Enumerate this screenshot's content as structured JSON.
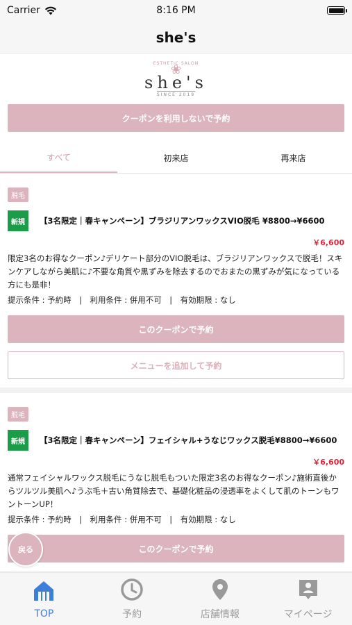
{
  "status_bar": {
    "carrier": "Carrier",
    "time": "8:16 PM"
  },
  "nav": {
    "title": "she's"
  },
  "logo": {
    "arc_text": "ESTHETIC SALON",
    "main": "she's",
    "sub": "SINCE 2019"
  },
  "reserve_without_coupon": "クーポンを利用しないで予約",
  "tabs": [
    {
      "label": "すべて",
      "active": true
    },
    {
      "label": "初来店",
      "active": false
    },
    {
      "label": "再来店",
      "active": false
    }
  ],
  "coupons": [
    {
      "category": "脱毛",
      "badge": "新規",
      "title": "【3名限定｜春キャンペーン】ブラジリアンワックスVIO脱毛 ¥8800→¥6600",
      "price": "￥6,600",
      "description": "限定3名のお得なクーポン♪デリケート部分のVIO脱毛は、ブラジリアンワックスで脱毛！スキンケアしながら美肌に♪不要な角質や黒ずみを除去するのでおまたの黒ずみが気になっている方にも是非！",
      "conditions": "提示条件 : 予約時　|　利用条件 : 併用不可　|　有効期限 : なし",
      "reserve_label": "このクーポンで予約",
      "add_menu_label": "メニューを追加して予約"
    },
    {
      "category": "脱毛",
      "badge": "新規",
      "title": "【3名限定｜春キャンペーン】フェイシャル+うなじワックス脱毛¥8800→¥6600",
      "price": "￥6,600",
      "description": "通常フェイシャルワックス脱毛にうなじ脱毛もついた限定3名のお得なクーポン♪施術直後からツルツル美肌へ♪うぶ毛＋古い角質除去で、基礎化粧品の浸透率をよくして肌のトーンもワントーンUP！",
      "conditions": "提示条件 : 予約時　|　利用条件 : 併用不可　|　有効期限 : なし",
      "reserve_label": "このクーポンで予約"
    }
  ],
  "back_button": "戻る",
  "tab_bar": [
    {
      "label": "TOP",
      "icon": "home-icon",
      "active": true
    },
    {
      "label": "予約",
      "icon": "clock-icon",
      "active": false
    },
    {
      "label": "店舗情報",
      "icon": "map-pin-icon",
      "active": false
    },
    {
      "label": "マイページ",
      "icon": "profile-badge-icon",
      "active": false
    }
  ],
  "colors": {
    "accent_pink": "#dbb4bd",
    "new_badge_green": "#1a9c48",
    "price_red": "#e0243c",
    "active_tab_blue": "#3d7ed9"
  }
}
